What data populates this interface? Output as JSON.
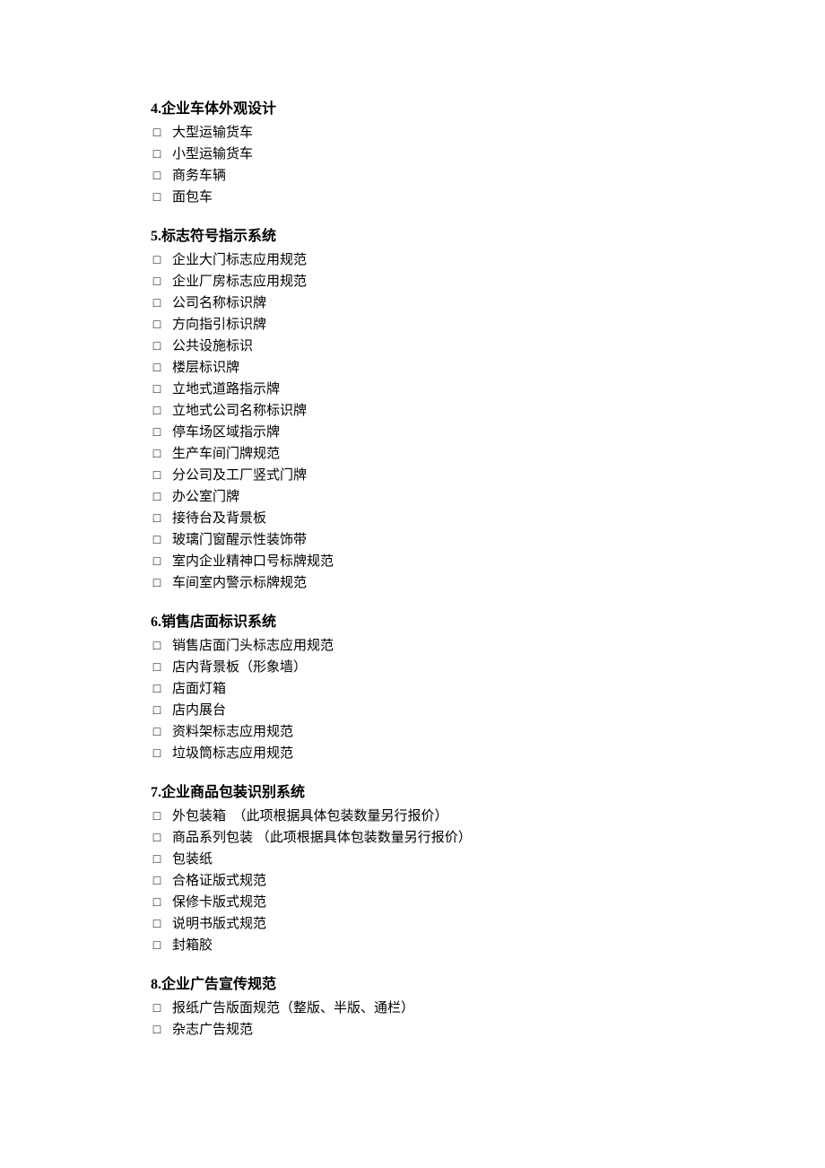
{
  "sections": [
    {
      "heading": "4.企业车体外观设计",
      "items": [
        "大型运输货车",
        "小型运输货车",
        "商务车辆",
        "面包车"
      ]
    },
    {
      "heading": "5.标志符号指示系统",
      "items": [
        "企业大门标志应用规范",
        "企业厂房标志应用规范",
        "公司名称标识牌",
        "方向指引标识牌",
        "公共设施标识",
        "楼层标识牌",
        "立地式道路指示牌",
        "立地式公司名称标识牌",
        "停车场区域指示牌",
        "生产车间门牌规范",
        "分公司及工厂竖式门牌",
        "办公室门牌",
        "接待台及背景板",
        "玻璃门窗醒示性装饰带",
        "室内企业精神口号标牌规范",
        "车间室内警示标牌规范"
      ]
    },
    {
      "heading": "6.销售店面标识系统",
      "items": [
        "销售店面门头标志应用规范",
        "店内背景板（形象墙）",
        "店面灯箱",
        "店内展台",
        "资料架标志应用规范",
        "垃圾筒标志应用规范"
      ]
    },
    {
      "heading": "7.企业商品包装识别系统",
      "items": [
        "外包装箱  （此项根据具体包装数量另行报价）",
        "商品系列包装 （此项根据具体包装数量另行报价）",
        "包装纸",
        "合格证版式规范",
        "保修卡版式规范",
        "说明书版式规范",
        "封箱胶"
      ]
    },
    {
      "heading": "8.企业广告宣传规范",
      "items": [
        "报纸广告版面规范（整版、半版、通栏）",
        "杂志广告规范"
      ]
    }
  ],
  "checkbox_glyph": "□"
}
